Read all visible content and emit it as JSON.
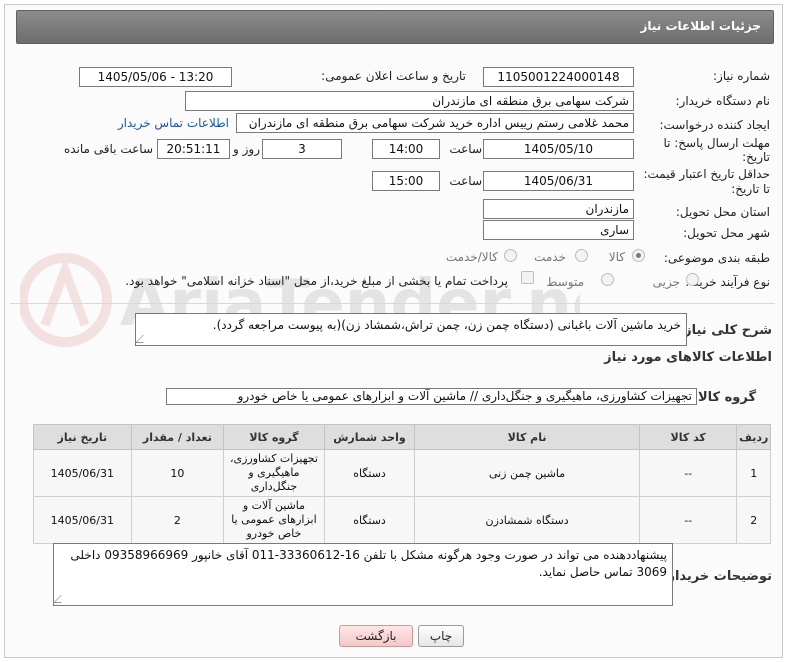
{
  "panel_title": "جزئیات اطلاعات نیاز",
  "fields": {
    "need_number_label": "شماره نیاز:",
    "need_number": "1105001224000148",
    "announce_label": "تاریخ و ساعت اعلان عمومی:",
    "announce_value": "1405/05/06 - 13:20",
    "buyer_org_label": "نام دستگاه خریدار:",
    "buyer_org": "شرکت سهامی برق منطقه ای مازندران",
    "creator_label": "ایجاد کننده درخواست:",
    "creator": "محمد غلامی رستم رییس اداره خرید شرکت سهامی برق منطقه ای مازندران",
    "contact_link": "اطلاعات تماس خریدار",
    "deadline_label_1": "مهلت ارسال پاسخ: تا",
    "deadline_label_2": "تاریخ:",
    "deadline_date": "1405/05/10",
    "time_label": "ساعت",
    "deadline_time": "14:00",
    "days_value": "3",
    "days_label": "روز و",
    "remaining_time": "20:51:11",
    "remaining_label": "ساعت باقی مانده",
    "validity_label_1": "حداقل تاریخ اعتبار قیمت:",
    "validity_label_2": "تا تاریخ:",
    "validity_date": "1405/06/31",
    "validity_time": "15:00",
    "province_label": "استان محل تحویل:",
    "province": "مازندران",
    "city_label": "شهر محل تحویل:",
    "city": "ساری",
    "category_label": "طبقه بندی موضوعی:",
    "category_options": [
      "کالا",
      "خدمت",
      "کالا/خدمت"
    ],
    "category_selected": "کالا",
    "process_label": "نوع فرآیند خرید :",
    "process_options": [
      "جزیی",
      "متوسط"
    ],
    "process_selected": "جزیی",
    "payment_note": "پرداخت تمام یا بخشی از مبلغ خرید،از محل \"اسناد خزانه اسلامی\" خواهد بود."
  },
  "description": {
    "label": "شرح کلی نیاز:",
    "text": "خرید ماشین آلات باغبانی (دستگاه چمن زن، چمن تراش،شمشاد زن)(به پیوست مراجعه گردد)."
  },
  "goods_section_title": "اطلاعات کالاهای مورد نیاز",
  "goods_group": {
    "label": "گروه کالا:",
    "value": "تجهیزات کشاورزی، ماهیگیری و جنگل‌داری //  ماشین آلات و ابزارهای عمومی یا خاص خودرو"
  },
  "table": {
    "headers": [
      "ردیف",
      "کد کالا",
      "نام کالا",
      "واحد شمارش",
      "گروه کالا",
      "تعداد / مقدار",
      "تاریخ نیاز"
    ],
    "rows": [
      [
        "1",
        "--",
        "ماشین چمن زنی",
        "دستگاه",
        "تجهیزات کشاورزی، ماهیگیری و جنگل‌داری",
        "10",
        "1405/06/31"
      ],
      [
        "2",
        "--",
        "دستگاه شمشادزن",
        "دستگاه",
        "ماشین آلات و ابزارهای عمومی یا خاص خودرو",
        "2",
        "1405/06/31"
      ]
    ]
  },
  "buyer_notes": {
    "label": "توضیحات خریدار:",
    "text": "پیشنهاددهنده می تواند در صورت وجود هرگونه مشکل با تلفن 16-33360612-011 آقای خانپور  09358966969 داخلی 3069 تماس حاصل نماید."
  },
  "buttons": {
    "print": "چاپ",
    "back": "بازگشت"
  },
  "watermark_text": "AriaTender.net"
}
